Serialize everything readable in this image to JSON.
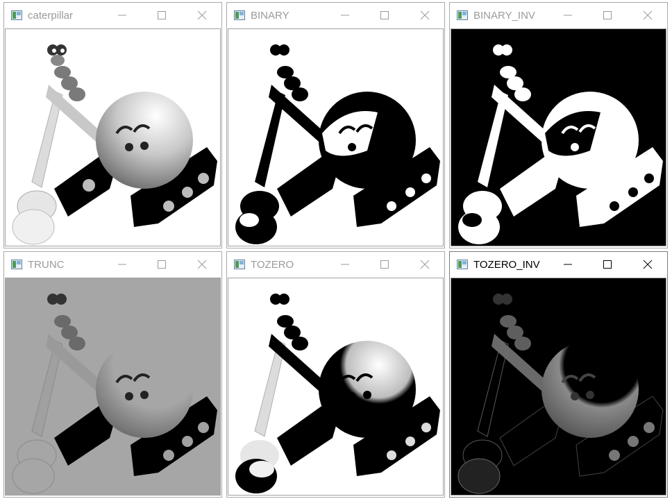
{
  "windows": [
    {
      "title": "caterpillar",
      "mode": "original"
    },
    {
      "title": "BINARY",
      "mode": "binary"
    },
    {
      "title": "BINARY_INV",
      "mode": "binary_inv"
    },
    {
      "title": "TRUNC",
      "mode": "trunc"
    },
    {
      "title": "TOZERO",
      "mode": "tozero"
    },
    {
      "title": "TOZERO_INV",
      "mode": "tozero_inv"
    }
  ],
  "active_window": "TOZERO_INV",
  "icons": [
    "app-icon",
    "minimize-icon",
    "maximize-icon",
    "close-icon"
  ],
  "colors": {
    "inactive_title": "#9a9a9a",
    "active_title": "#000000",
    "trunc_background": "#a6a6a6"
  }
}
